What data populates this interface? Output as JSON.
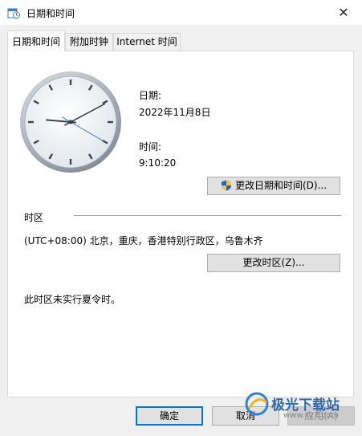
{
  "window": {
    "title": "日期和时间",
    "close_glyph": "✕"
  },
  "tabs": [
    {
      "label": "日期和时间",
      "active": true
    },
    {
      "label": "附加时钟",
      "active": false
    },
    {
      "label": "Internet 时间",
      "active": false
    }
  ],
  "clock": {
    "hour": 9,
    "minute": 10,
    "second": 20
  },
  "date": {
    "label": "日期:",
    "value": "2022年11月8日"
  },
  "time": {
    "label": "时间:",
    "value": "9:10:20"
  },
  "change_datetime_button": "更改日期和时间(D)...",
  "timezone": {
    "section_label": "时区",
    "value": "(UTC+08:00) 北京，重庆，香港特别行政区，乌鲁木齐",
    "change_button": "更改时区(Z)...",
    "dst_note": "此时区未实行夏令时。"
  },
  "footer": {
    "ok": "确定",
    "cancel": "取消",
    "apply": "应用(A)"
  },
  "watermark": {
    "text": "极光下载站",
    "url": "www.xz7.com"
  },
  "colors": {
    "accent": "#0078d7",
    "window_bg": "#f0f0f0",
    "panel_bg": "#ffffff"
  },
  "icons": {
    "app": "clock-calendar-icon",
    "shield": "uac-shield-icon",
    "close": "close-icon"
  }
}
